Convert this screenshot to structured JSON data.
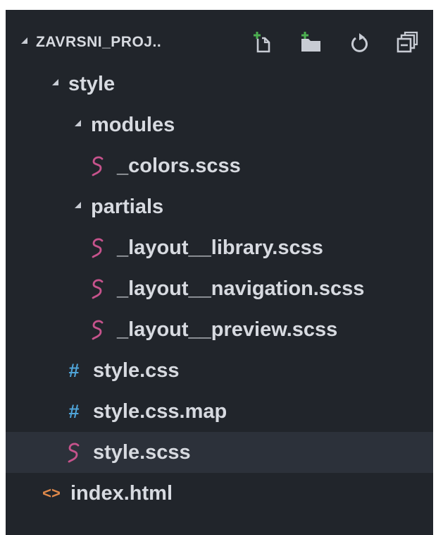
{
  "explorer": {
    "project_name": "ZAVRSNI_PROJ..",
    "actions": [
      {
        "name": "new-file-icon"
      },
      {
        "name": "new-folder-icon"
      },
      {
        "name": "refresh-icon"
      },
      {
        "name": "collapse-all-icon"
      }
    ],
    "tree": [
      {
        "label": "style",
        "type": "folder",
        "icon": "twisty-expanded"
      },
      {
        "label": "modules",
        "type": "folder",
        "icon": "twisty-expanded"
      },
      {
        "label": "_colors.scss",
        "type": "scss",
        "icon": "sass-icon"
      },
      {
        "label": "partials",
        "type": "folder",
        "icon": "twisty-expanded"
      },
      {
        "label": "_layout__library.scss",
        "type": "scss",
        "icon": "sass-icon"
      },
      {
        "label": "_layout__navigation.scss",
        "type": "scss",
        "icon": "sass-icon"
      },
      {
        "label": "_layout__preview.scss",
        "type": "scss",
        "icon": "sass-icon"
      },
      {
        "label": "style.css",
        "type": "css",
        "icon": "hash-icon"
      },
      {
        "label": "style.css.map",
        "type": "css",
        "icon": "hash-icon"
      },
      {
        "label": "style.scss",
        "type": "scss",
        "icon": "sass-icon",
        "selected": true
      },
      {
        "label": "index.html",
        "type": "html",
        "icon": "html-icon"
      }
    ]
  },
  "colors": {
    "panel_bg": "#21252b",
    "selected_bg": "#2c313a",
    "text": "#d7dae0",
    "sass": "#c6538c",
    "css": "#4fa4d8",
    "html": "#e0894a",
    "add_green": "#4caf50"
  }
}
